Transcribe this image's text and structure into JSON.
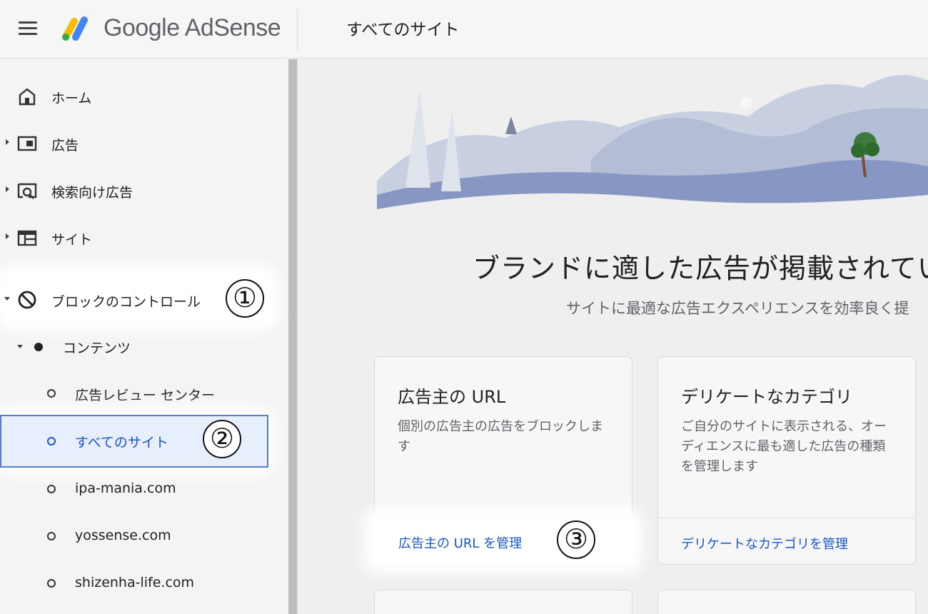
{
  "header": {
    "logo_text": "Google AdSense",
    "page_title": "すべてのサイト"
  },
  "sidebar": {
    "items": [
      {
        "label": "ホーム",
        "icon": "home-icon"
      },
      {
        "label": "広告",
        "icon": "ads-icon"
      },
      {
        "label": "検索向け広告",
        "icon": "search-ads-icon"
      },
      {
        "label": "サイト",
        "icon": "sites-icon"
      },
      {
        "label": "ブロックのコントロール",
        "icon": "block-icon"
      }
    ],
    "sub_item": {
      "label": "コンテンツ"
    },
    "leaves": [
      {
        "label": "広告レビュー センター"
      },
      {
        "label": "すべてのサイト",
        "selected": true
      },
      {
        "label": "ipa-mania.com"
      },
      {
        "label": "yossense.com"
      },
      {
        "label": "shizenha-life.com"
      }
    ]
  },
  "annotations": {
    "one": "①",
    "two": "②",
    "three": "③"
  },
  "main": {
    "headline": "ブランドに適した広告が掲載されてい",
    "subheadline": "サイトに最適な広告エクスペリエンスを効率良く提",
    "cards": [
      {
        "title": "広告主の URL",
        "description": "個別の広告主の広告をブロックします",
        "link": "広告主の URL を管理"
      },
      {
        "title": "デリケートなカテゴリ",
        "description": "ご自分のサイトに表示される、オーディエンスに最も適した広告の種類を管理します",
        "link": "デリケートなカテゴリを管理"
      }
    ]
  },
  "colors": {
    "accent": "#1a57c9",
    "selected_bg": "#e7eefc"
  }
}
